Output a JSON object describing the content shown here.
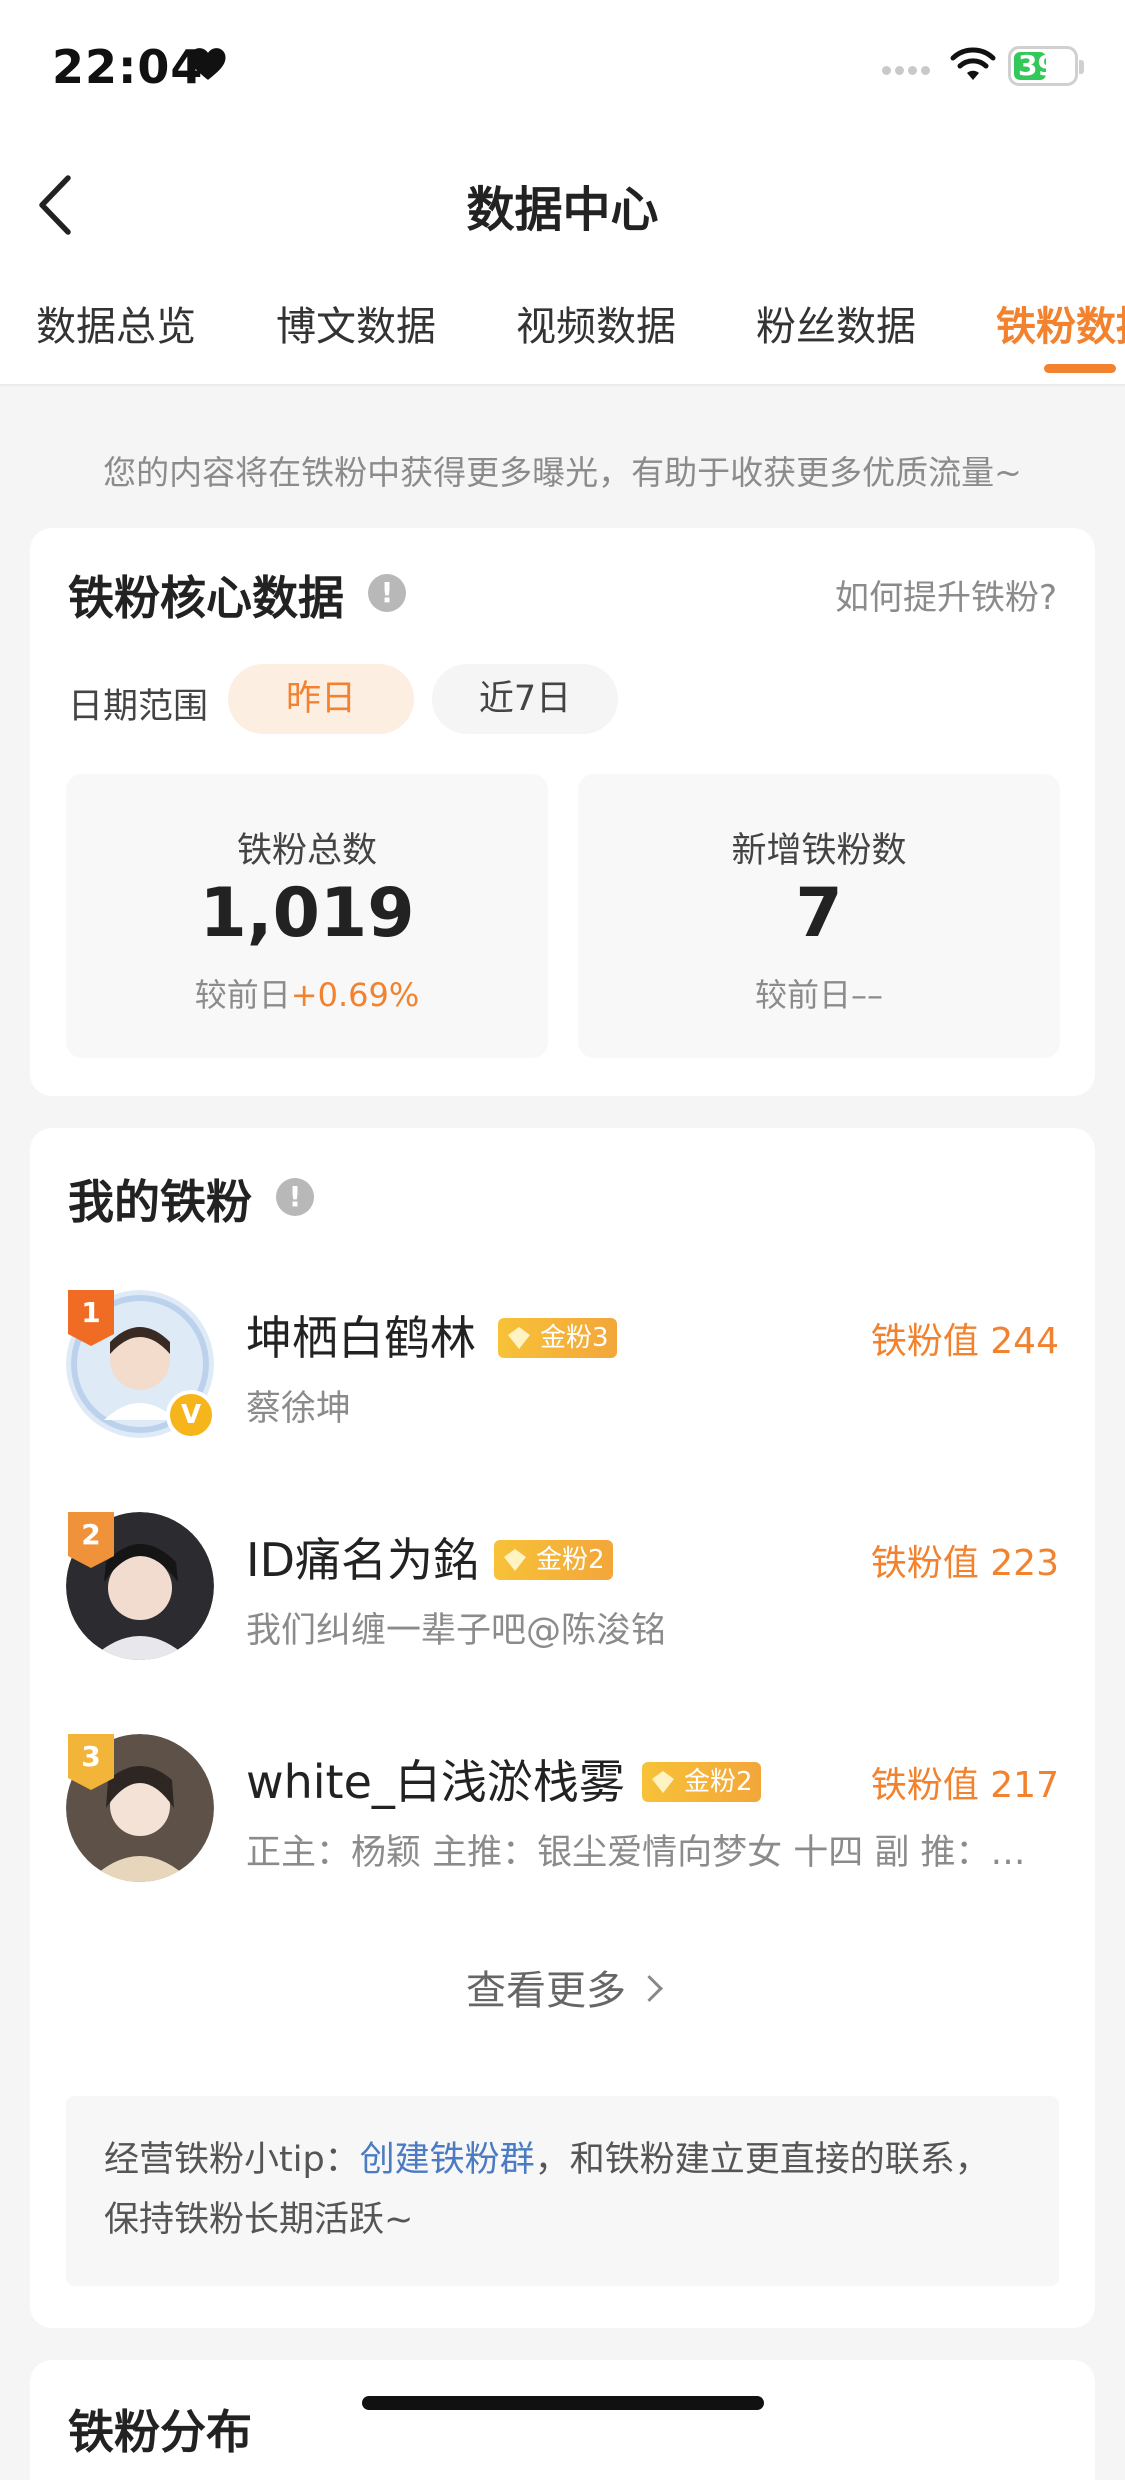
{
  "status_bar": {
    "time": "22:04",
    "battery": "39"
  },
  "nav": {
    "title": "数据中心"
  },
  "tabs": [
    {
      "label": "数据总览"
    },
    {
      "label": "博文数据"
    },
    {
      "label": "视频数据"
    },
    {
      "label": "粉丝数据"
    },
    {
      "label": "铁粉数据",
      "active": true
    }
  ],
  "notice": "您的内容将在铁粉中获得更多曝光，有助于收获更多优质流量~",
  "core": {
    "title": "铁粉核心数据",
    "help_link": "如何提升铁粉?",
    "date_label": "日期范围",
    "chips": [
      "昨日",
      "近7日"
    ],
    "stats": [
      {
        "label": "铁粉总数",
        "value": "1,019",
        "sub_prefix": "较前日",
        "sub_value": "+0.69%"
      },
      {
        "label": "新增铁粉数",
        "value": "7",
        "sub_prefix": "较前日",
        "sub_value": "––"
      }
    ]
  },
  "my_fans": {
    "title": "我的铁粉",
    "items": [
      {
        "rank": "1",
        "name": "坤栖白鹤林",
        "badge": "金粉3",
        "desc": "蔡徐坤",
        "value": "铁粉值 244",
        "verified": true
      },
      {
        "rank": "2",
        "name": "ID痛名为銘",
        "badge": "金粉2",
        "desc": "我们纠缠一辈子吧@陈浚铭",
        "value": "铁粉值 223",
        "verified": false
      },
      {
        "rank": "3",
        "name": "white_白浅淤栈雾",
        "badge": "金粉2",
        "desc": "正主：杨颖 主推：银尘爱情向梦女 十四 副 推：…",
        "value": "铁粉值 217",
        "verified": false
      }
    ],
    "see_more": "查看更多",
    "tip_prefix": "经营铁粉小tip：",
    "tip_link": "创建铁粉群",
    "tip_suffix": "，和铁粉建立更直接的联系，保持铁粉长期活跃~"
  },
  "distribution": {
    "title": "铁粉分布"
  },
  "colors": {
    "accent": "#f2822e",
    "link": "#4b7bc3"
  }
}
